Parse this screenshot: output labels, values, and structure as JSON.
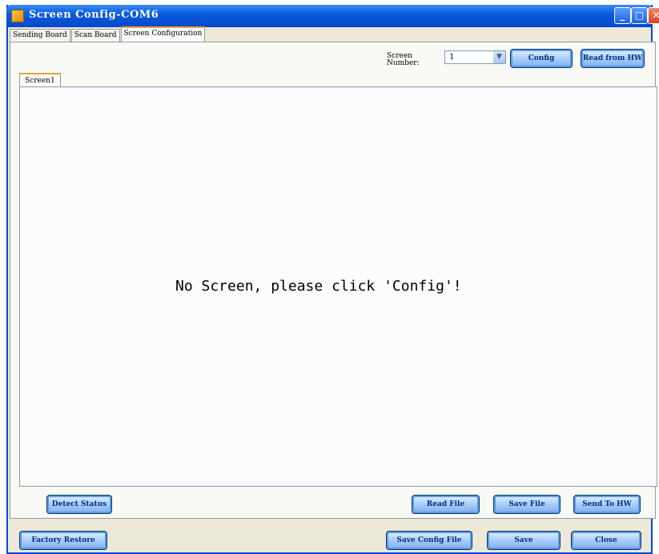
{
  "window": {
    "title": "Screen Config-COM6",
    "minimize": "_",
    "maximize": "□",
    "close": "✕"
  },
  "tabs": [
    {
      "label": "Sending Board"
    },
    {
      "label": "Scan Board"
    },
    {
      "label": "Screen Configuration"
    }
  ],
  "screen_number": {
    "label": "Screen Number:",
    "value": "1"
  },
  "buttons": {
    "config": "Config",
    "read_from_hw": "Read from HW",
    "detect_status": "Detect Status",
    "read_file": "Read File",
    "save_file": "Save File",
    "send_to_hw": "Send To HW",
    "factory_restore": "Factory Restore",
    "save_config_file": "Save Config File",
    "save": "Save",
    "close": "Close"
  },
  "inner_tab": {
    "label": "Screen1"
  },
  "message": "No Screen, please click 'Config'!"
}
